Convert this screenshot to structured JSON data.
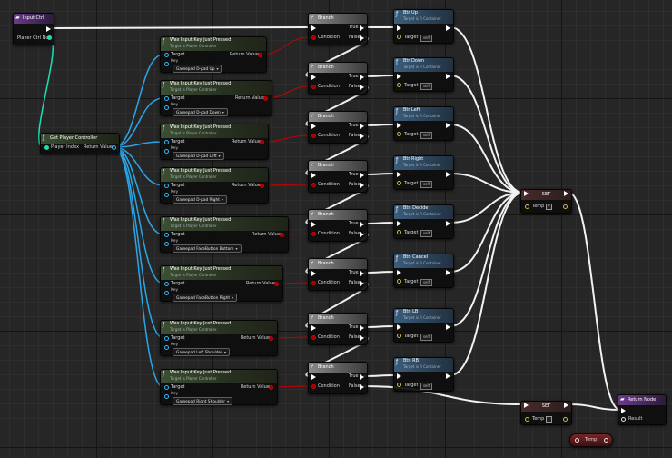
{
  "input_event": {
    "title": "Input Ctrl",
    "pin_label": "Player Ctrl No."
  },
  "get_player_controller": {
    "title": "Get Player Controller",
    "in_label": "Player Index",
    "out_label": "Return Value"
  },
  "key_nodes": [
    {
      "title": "Was Input Key Just Pressed",
      "subtitle": "Target is Player Controller",
      "target": "Target",
      "return": "Return Value",
      "key": "Key",
      "key_value": "Gamepad D-pad Up"
    },
    {
      "title": "Was Input Key Just Pressed",
      "subtitle": "Target is Player Controller",
      "target": "Target",
      "return": "Return Value",
      "key": "Key",
      "key_value": "Gamepad D-pad Down"
    },
    {
      "title": "Was Input Key Just Pressed",
      "subtitle": "Target is Player Controller",
      "target": "Target",
      "return": "Return Value",
      "key": "Key",
      "key_value": "Gamepad D-pad Left"
    },
    {
      "title": "Was Input Key Just Pressed",
      "subtitle": "Target is Player Controller",
      "target": "Target",
      "return": "Return Value",
      "key": "Key",
      "key_value": "Gamepad D-pad Right"
    },
    {
      "title": "Was Input Key Just Pressed",
      "subtitle": "Target is Player Controller",
      "target": "Target",
      "return": "Return Value",
      "key": "Key",
      "key_value": "Gamepad FaceButton Bottom"
    },
    {
      "title": "Was Input Key Just Pressed",
      "subtitle": "Target is Player Controller",
      "target": "Target",
      "return": "Return Value",
      "key": "Key",
      "key_value": "Gamepad FaceButton Right"
    },
    {
      "title": "Was Input Key Just Pressed",
      "subtitle": "Target is Player Controller",
      "target": "Target",
      "return": "Return Value",
      "key": "Key",
      "key_value": "Gamepad Left Shoulder"
    },
    {
      "title": "Was Input Key Just Pressed",
      "subtitle": "Target is Player Controller",
      "target": "Target",
      "return": "Return Value",
      "key": "Key",
      "key_value": "Gamepad Right Shoulder"
    }
  ],
  "branch_nodes": [
    {
      "title": "Branch",
      "condition": "Condition",
      "true": "True",
      "false": "False"
    },
    {
      "title": "Branch",
      "condition": "Condition",
      "true": "True",
      "false": "False"
    },
    {
      "title": "Branch",
      "condition": "Condition",
      "true": "True",
      "false": "False"
    },
    {
      "title": "Branch",
      "condition": "Condition",
      "true": "True",
      "false": "False"
    },
    {
      "title": "Branch",
      "condition": "Condition",
      "true": "True",
      "false": "False"
    },
    {
      "title": "Branch",
      "condition": "Condition",
      "true": "True",
      "false": "False"
    },
    {
      "title": "Branch",
      "condition": "Condition",
      "true": "True",
      "false": "False"
    },
    {
      "title": "Branch",
      "condition": "Condition",
      "true": "True",
      "false": "False"
    }
  ],
  "call_nodes": [
    {
      "title": "Btr Up",
      "subtitle": "Target is R Container",
      "target": "Target",
      "self": "self"
    },
    {
      "title": "Btr Down",
      "subtitle": "Target is R Container",
      "target": "Target",
      "self": "self"
    },
    {
      "title": "Btr Left",
      "subtitle": "Target is R Container",
      "target": "Target",
      "self": "self"
    },
    {
      "title": "Btr Right",
      "subtitle": "Target is R Container",
      "target": "Target",
      "self": "self"
    },
    {
      "title": "Btn Decide",
      "subtitle": "Target is R Container",
      "target": "Target",
      "self": "self"
    },
    {
      "title": "Btn Cancel",
      "subtitle": "Target is R Container",
      "target": "Target",
      "self": "self"
    },
    {
      "title": "Btn LB",
      "subtitle": "Target is R Container",
      "target": "Target",
      "self": "self"
    },
    {
      "title": "Btn RB",
      "subtitle": "Target is R Container",
      "target": "Target",
      "self": "self"
    }
  ],
  "set_true": {
    "title": "SET",
    "pin": "Temp",
    "checked": "✓"
  },
  "set_false": {
    "title": "SET",
    "pin": "Temp"
  },
  "return_node": {
    "title": "Return Node",
    "pin": "Result"
  },
  "temp_var": {
    "label": "Temp"
  },
  "colors": {
    "exec": "#ffffff",
    "object": "#3ab4f0",
    "boolean": "#9a0000",
    "function_header": "#3c4f33",
    "call_header": "#3b5e7d",
    "event_header": "#6c3b8a"
  }
}
